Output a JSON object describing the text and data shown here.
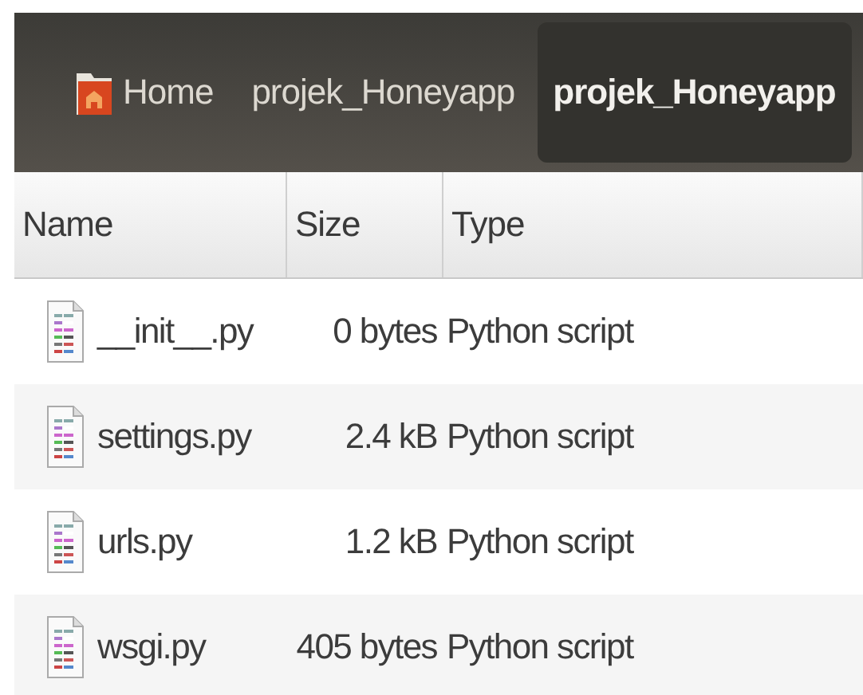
{
  "breadcrumbs": [
    {
      "label": "Home",
      "kind": "home",
      "selected": false
    },
    {
      "label": "projek_Honeyapp",
      "kind": "folder",
      "selected": false
    },
    {
      "label": "projek_Honeyapp",
      "kind": "folder",
      "selected": true
    }
  ],
  "table": {
    "columns": [
      "Name",
      "Size",
      "Type"
    ],
    "rows": [
      {
        "name": "__init__.py",
        "size": "0 bytes",
        "type": "Python script"
      },
      {
        "name": "settings.py",
        "size": "2.4 kB",
        "type": "Python script"
      },
      {
        "name": "urls.py",
        "size": "1.2 kB",
        "type": "Python script"
      },
      {
        "name": "wsgi.py",
        "size": "405 bytes",
        "type": "Python script"
      }
    ]
  }
}
